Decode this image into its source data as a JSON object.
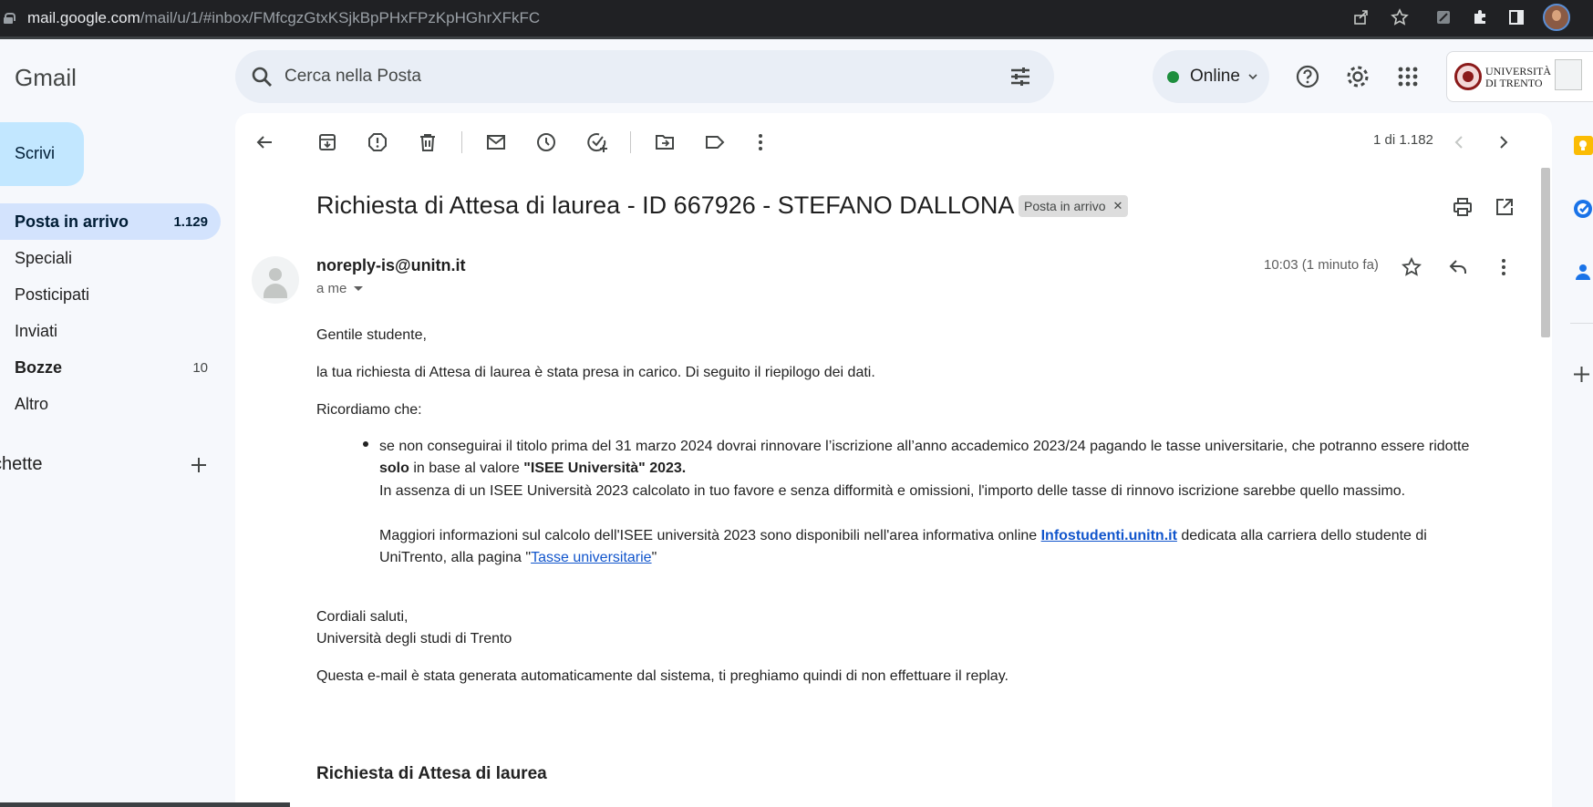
{
  "browser": {
    "url_host": "mail.google.com",
    "url_path": "/mail/u/1/#inbox/FMfcgzGtxKSjkBpPHxFPzKpHGhrXFkFC"
  },
  "header": {
    "app_name": "Gmail",
    "search_placeholder": "Cerca nella Posta",
    "status": "Online",
    "org_name_line1": "UNIVERSITÀ",
    "org_name_line2": "DI TRENTO"
  },
  "sidebar": {
    "compose_label": "Scrivi",
    "items": [
      {
        "label": "Posta in arrivo",
        "count": "1.129"
      },
      {
        "label": "Speciali",
        "count": ""
      },
      {
        "label": "Posticipati",
        "count": ""
      },
      {
        "label": "Inviati",
        "count": ""
      },
      {
        "label": "Bozze",
        "count": "10"
      },
      {
        "label": "Altro",
        "count": ""
      }
    ],
    "labels_header": "chette"
  },
  "toolbar": {
    "pager": "1 di 1.182"
  },
  "message": {
    "subject": "Richiesta di Attesa di laurea - ID 667926 - STEFANO DALLONA",
    "label_chip": "Posta in arrivo",
    "sender": "noreply-is@unitn.it",
    "recipients": "a me",
    "time": "10:03 (1 minuto fa)",
    "greeting": "Gentile studente,",
    "intro": "la tua richiesta di Attesa di laurea è stata presa in carico. Di seguito il riepilogo dei dati.",
    "reminder": "Ricordiamo che:",
    "bullet_line1": "se non conseguirai il titolo prima del 31 marzo 2024 dovrai rinnovare l’iscrizione all’anno accademico 2023/24 pagando le tasse universitarie, che potranno essere ridotte",
    "bullet_line2_bold1": "solo",
    "bullet_line2_mid": " in base al valore ",
    "bullet_line2_bold2": "\"ISEE Università\" 2023.",
    "bullet_line3": "In assenza di un ISEE Università 2023 calcolato in tuo favore e senza difformità e omissioni, l'importo delle tasse di rinnovo iscrizione sarebbe quello massimo.",
    "bullet_line4_pre": "Maggiori informazioni sul calcolo dell'ISEE università 2023 sono disponibili nell'area informativa online ",
    "bullet_line4_link": "Infostudenti.unitn.it",
    "bullet_line4_post": " dedicata alla carriera dello studente di",
    "bullet_line5_pre": "UniTrento, alla pagina \"",
    "bullet_line5_link": "Tasse universitarie",
    "bullet_line5_post": "\"",
    "closing": "Cordiali saluti,",
    "signature": "Università degli studi di Trento",
    "auto_note": "Questa e-mail è stata generata automaticamente dal sistema, ti preghiamo quindi di non effettuare il replay.",
    "summary_heading": "Richiesta di Attesa di laurea"
  },
  "colors": {
    "accent_compose": "#c2e7ff",
    "active_nav": "#d3e3fd",
    "online_dot": "#1e8e3e",
    "link": "#1155cc"
  }
}
